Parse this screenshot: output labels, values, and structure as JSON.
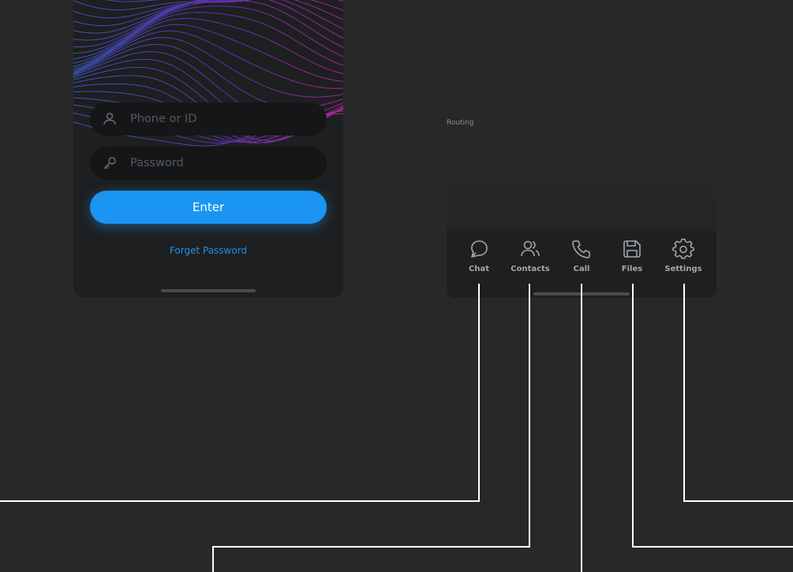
{
  "login": {
    "phone_placeholder": "Phone or ID",
    "password_placeholder": "Password",
    "enter_label": "Enter",
    "forget_label": "Forget Password"
  },
  "routing": {
    "label": "Routing",
    "tabs": [
      {
        "label": "Chat",
        "icon": "chat-icon"
      },
      {
        "label": "Contacts",
        "icon": "contacts-icon"
      },
      {
        "label": "Call",
        "icon": "call-icon"
      },
      {
        "label": "Files",
        "icon": "files-icon"
      },
      {
        "label": "Settings",
        "icon": "settings-icon"
      }
    ]
  },
  "colors": {
    "background": "#282828",
    "card": "#1e1f20",
    "field": "#151617",
    "accent": "#1a95f2",
    "link": "#1e8fe6",
    "wave_blue": "#3f5fd8",
    "wave_magenta": "#c026a8",
    "connector": "#ffffff"
  }
}
